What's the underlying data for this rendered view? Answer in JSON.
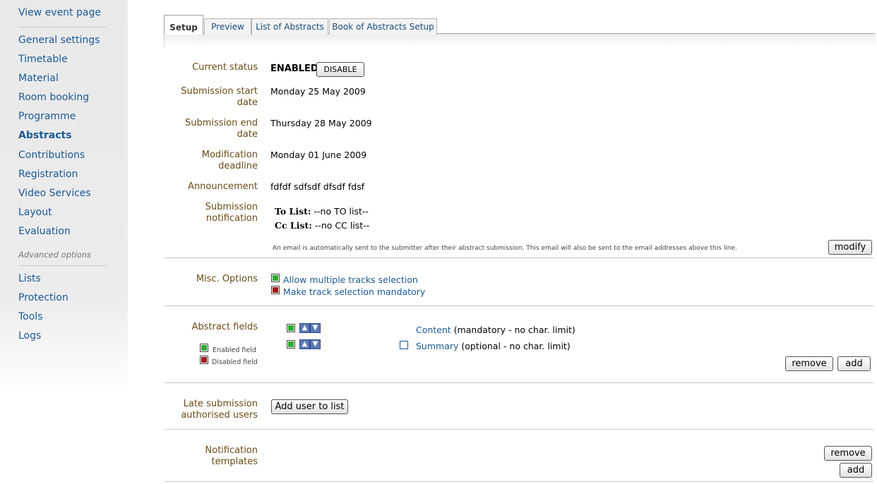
{
  "sidebar": {
    "view_event": "View event page",
    "items": [
      "General settings",
      "Timetable",
      "Material",
      "Room booking",
      "Programme",
      "Abstracts",
      "Contributions",
      "Registration",
      "Video Services",
      "Layout",
      "Evaluation"
    ],
    "advanced_label": "Advanced options",
    "advanced_items": [
      "Lists",
      "Protection",
      "Tools",
      "Logs"
    ]
  },
  "tabs": [
    "Setup",
    "Preview",
    "List of Abstracts",
    "Book of Abstracts Setup"
  ],
  "status": {
    "label": "Current status",
    "value": "ENABLED",
    "button": "DISABLE"
  },
  "start": {
    "label1": "Submission start",
    "label2": "date",
    "value": "Monday 25 May 2009"
  },
  "end": {
    "label1": "Submission end",
    "label2": "date",
    "value": "Thursday 28 May 2009"
  },
  "modif": {
    "label1": "Modification",
    "label2": "deadline",
    "value": "Monday 01 June 2009"
  },
  "announcement": {
    "label": "Announcement",
    "value": "fdfdf sdfsdf dfsdf fdsf"
  },
  "notification": {
    "label1": "Submission",
    "label2": "notification",
    "to_label": "To List:",
    "to_value": "--no TO list--",
    "cc_label": "Cc List:",
    "cc_value": "--no CC list--",
    "note": "An email is automatically sent to the submitter after their abstract submission. This email will also be sent to the email addresses above this line.",
    "modify_button": "modify"
  },
  "misc": {
    "label": "Misc. Options",
    "opt1": "Allow multiple tracks selection",
    "opt2": "Make track selection mandatory"
  },
  "fields": {
    "label": "Abstract fields",
    "legend_enabled": "Enabled field",
    "legend_disabled": "Disabled field",
    "f1_name": "Content",
    "f1_desc": "(mandatory - no char. limit)",
    "f2_name": "Summary",
    "f2_desc": "(optional - no char. limit)",
    "remove_button": "remove",
    "add_button": "add"
  },
  "late": {
    "label1": "Late submission",
    "label2": "authorised users",
    "button": "Add user to list"
  },
  "templates": {
    "label1": "Notification",
    "label2": "templates",
    "remove_button": "remove",
    "add_button": "add"
  },
  "colors": {
    "link": "#1a5a96",
    "label": "#6b4b16",
    "enabled": "#2faa2f",
    "disabled": "#a01818"
  },
  "icons": {
    "up": "arrow-up-icon",
    "down": "arrow-down-icon"
  }
}
